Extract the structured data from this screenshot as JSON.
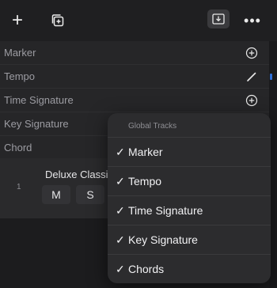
{
  "toolbar": {
    "add_symbol": "+",
    "more_symbol": "•••"
  },
  "global_tracks": [
    {
      "label": "Marker",
      "action": "plus-circle"
    },
    {
      "label": "Tempo",
      "action": "pencil"
    },
    {
      "label": "Time Signature",
      "action": "plus-circle"
    },
    {
      "label": "Key Signature",
      "action": ""
    },
    {
      "label": "Chord",
      "action": ""
    }
  ],
  "track": {
    "number": "1",
    "name": "Deluxe Classi",
    "mute_label": "M",
    "solo_label": "S"
  },
  "menu": {
    "title": "Global Tracks",
    "check_symbol": "✓",
    "items": [
      {
        "label": "Marker",
        "checked": true
      },
      {
        "label": "Tempo",
        "checked": true
      },
      {
        "label": "Time Signature",
        "checked": true
      },
      {
        "label": "Key Signature",
        "checked": true
      },
      {
        "label": "Chords",
        "checked": true
      }
    ]
  },
  "colors": {
    "background": "#1c1c1e",
    "row_background": "#262628",
    "menu_background": "#2c2c2e",
    "accent": "#2f6fd6"
  }
}
